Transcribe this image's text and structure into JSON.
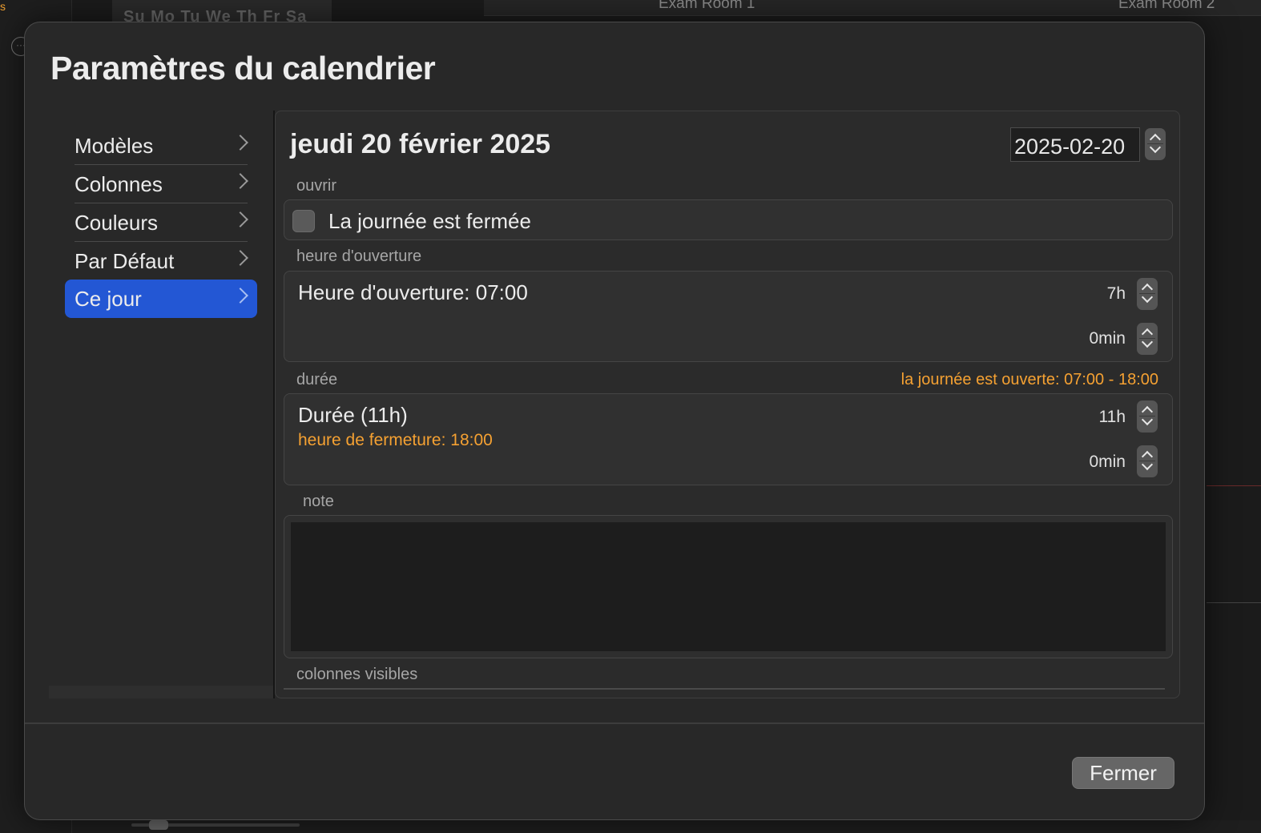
{
  "background": {
    "mini_calendar_days": "Su Mo Tu We Th Fr Sa",
    "room_1": "Exam Room 1",
    "room_2": "Exam Room 2"
  },
  "dialog": {
    "title": "Paramètres du calendrier",
    "close_label": "Fermer"
  },
  "sidebar": {
    "items": [
      {
        "label": "Modèles"
      },
      {
        "label": "Colonnes"
      },
      {
        "label": "Couleurs"
      },
      {
        "label": "Par Défaut"
      },
      {
        "label": "Ce jour",
        "selected": true
      }
    ],
    "selected_color": "#2357d4"
  },
  "day": {
    "title": "jeudi 20 février 2025",
    "date_value": "2025-02-20"
  },
  "open_section": {
    "label": "ouvrir",
    "closed_checkbox_label": "La journée est fermée",
    "closed_checked": false
  },
  "opening_section": {
    "label": "heure d'ouverture",
    "text": "Heure d'ouverture: 07:00",
    "hours": "7h",
    "minutes": "0min"
  },
  "duration_section": {
    "label": "durée",
    "open_range_note": "la journée est ouverte: 07:00 - 18:00",
    "text": "Durée (11h)",
    "closing_note": "heure de fermeture: 18:00",
    "hours": "11h",
    "minutes": "0min",
    "warning_color": "#f5a132"
  },
  "note_section": {
    "label": "note",
    "value": ""
  },
  "visible_columns_section": {
    "label": "colonnes visibles"
  }
}
